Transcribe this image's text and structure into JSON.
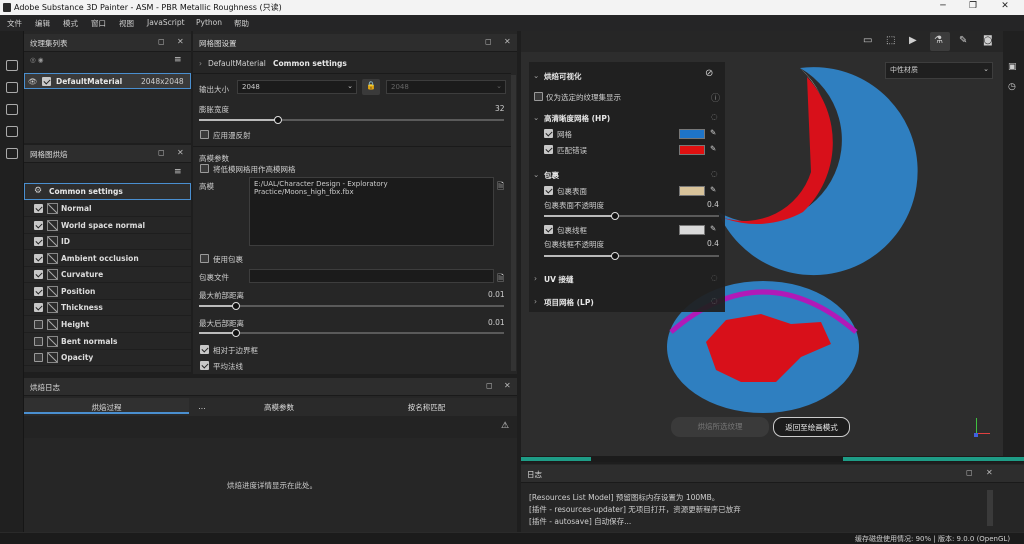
{
  "window": {
    "title": "Adobe Substance 3D Painter - ASM - PBR Metallic Roughness (只读)"
  },
  "menu": [
    "文件",
    "编辑",
    "模式",
    "窗口",
    "视图",
    "JavaScript",
    "Python",
    "帮助"
  ],
  "texture_set_panel": {
    "title": "纹理集列表",
    "items": [
      {
        "name": "DefaultMaterial",
        "size": "2048x2048"
      }
    ]
  },
  "bake_panel": {
    "title": "网格图烘焙",
    "common_settings": "Common settings",
    "maps": [
      {
        "label": "Normal",
        "checked": true
      },
      {
        "label": "World space normal",
        "checked": true
      },
      {
        "label": "ID",
        "checked": true
      },
      {
        "label": "Ambient occlusion",
        "checked": true
      },
      {
        "label": "Curvature",
        "checked": true
      },
      {
        "label": "Position",
        "checked": true
      },
      {
        "label": "Thickness",
        "checked": true
      },
      {
        "label": "Height",
        "checked": false
      },
      {
        "label": "Bent normals",
        "checked": false
      },
      {
        "label": "Opacity",
        "checked": false
      }
    ]
  },
  "settings_panel": {
    "title": "网格图设置",
    "breadcrumb_root": "DefaultMaterial",
    "breadcrumb_current": "Common settings",
    "output_size_label": "输出大小",
    "output_size_value": "2048",
    "output_size_locked": "2048",
    "dilation_label": "膨胀宽度",
    "dilation_value": "32",
    "dilation_fraction": 0.26,
    "diffusion_label": "应用漫反射",
    "hp_params_label": "高模参数",
    "use_low_as_high_label": "将低模网格用作高模网格",
    "high_poly_label": "高模",
    "high_poly_path": "E:/UAL/Character Design - Exploratory Practice/Moons_high_fbx.fbx",
    "use_cage_label": "使用包裹",
    "cage_file_label": "包裹文件",
    "max_front_label": "最大前部距离",
    "max_front_value": "0.01",
    "max_front_fraction": 0.12,
    "max_rear_label": "最大后部距离",
    "max_rear_value": "0.01",
    "max_rear_fraction": 0.12,
    "relative_label": "相对于边界框",
    "average_normals_label": "平均法线"
  },
  "log_panel": {
    "title": "烘焙日志",
    "tabs": [
      "烘焙过程",
      "...",
      "高模参数",
      "按名称匹配"
    ],
    "placeholder": "烘焙进度详情显示在此处。"
  },
  "viewport": {
    "material_select": "中性材质",
    "bake_button": "烘焙所选纹理",
    "return_button": "返回至绘画模式"
  },
  "bake_overlay": {
    "title": "烘焙可视化",
    "only_selected": "仅为选定的纹理集显示",
    "hp_section": "高清晰度网格 (HP)",
    "wireframe": "网格",
    "mismatch": "匹配错误",
    "wireframe_color": "#1e74c8",
    "mismatch_color": "#e01010",
    "cage_section": "包裹",
    "cage_surface": "包裹表面",
    "cage_surface_opacity_label": "包裹表面不透明度",
    "cage_surface_opacity": "0.4",
    "cage_surface_color": "#d8c39a",
    "cage_wire": "包裹线框",
    "cage_wire_opacity_label": "包裹线框不透明度",
    "cage_wire_opacity": "0.4",
    "cage_wire_color": "#d9d9d9",
    "uv_section": "UV 接缝",
    "lp_section": "项目网格 (LP)"
  },
  "log_window": {
    "title": "日志",
    "lines": [
      "[Resources List Model] 预留图标内存设置为 100MB。",
      "[插件 - resources-updater] 无项目打开，资源更新程序已放弃",
      "[插件 - autosave] 自动保存..."
    ]
  },
  "status": {
    "text": "缓存磁盘使用情况:  90% | 版本: 9.0.0 (OpenGL)"
  }
}
